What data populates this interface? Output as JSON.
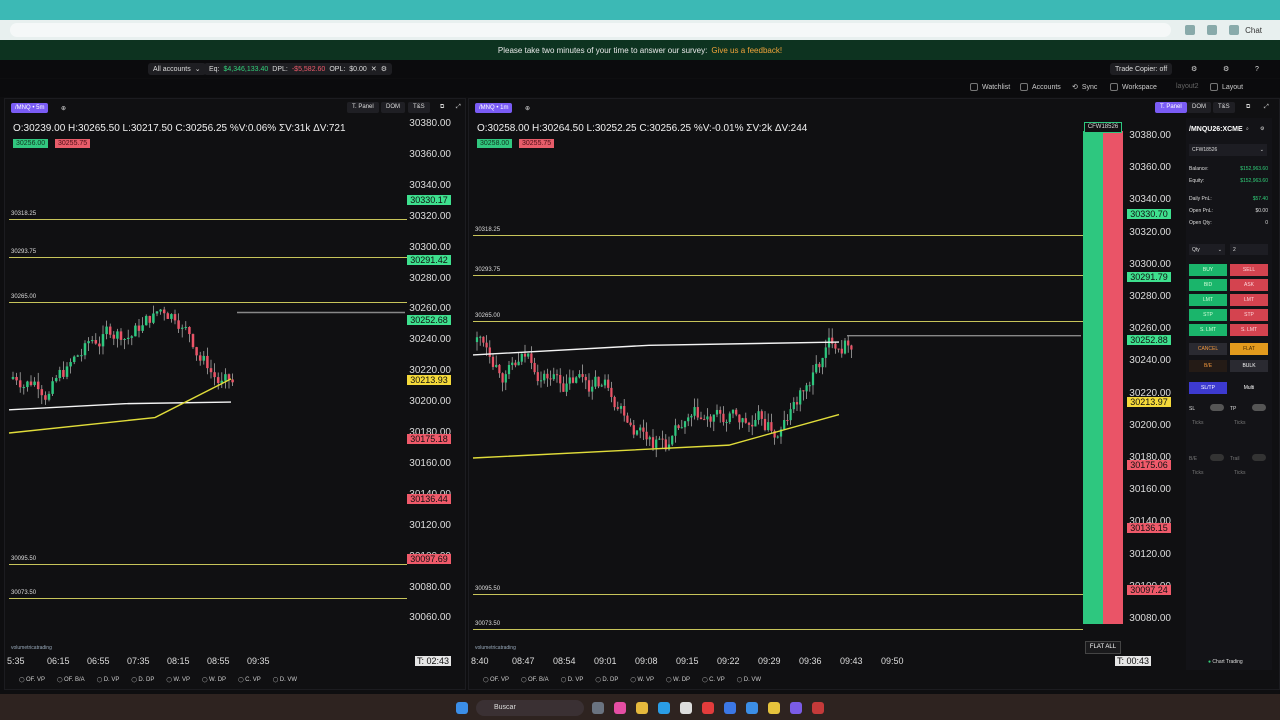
{
  "browser": {
    "chat_label": "Chat"
  },
  "survey": {
    "text": "Please take two minutes of your time to answer our survey:",
    "link": "Give us a feedback!"
  },
  "account_bar": {
    "accounts": "All accounts",
    "eq_label": "Eq:",
    "eq_value": "$4,346,133.40",
    "dpl_label": "DPL:",
    "dpl_value": "-$5,582.60",
    "opl_label": "OPL:",
    "opl_value": "$0.00",
    "trade_copier": "Trade Copier: off"
  },
  "toolbar": {
    "watchlist": "Watchlist",
    "accounts": "Accounts",
    "sync": "Sync",
    "workspace": "Workspace",
    "workspace_name": "layout2",
    "layout": "Layout"
  },
  "left_chart": {
    "symbol": "/MNQ",
    "interval": "5m",
    "tabs": [
      "T. Panel",
      "DOM",
      "T&S"
    ],
    "ohlc": "O:30239.00  H:30265.50  L:30217.50  C:30256.25  %V:0.06%  ΣV:31k  ΔV:721",
    "bid_badge": "30256.00",
    "ask_badge": "30255.75",
    "levels": [
      "30318.25",
      "30293.75",
      "30265.00",
      "30095.50",
      "30073.50"
    ],
    "yaxis": [
      "30380.00",
      "30360.00",
      "30340.00",
      "30320.00",
      "30300.00",
      "30280.00",
      "30260.00",
      "30240.00",
      "30220.00",
      "30200.00",
      "30180.00",
      "30160.00",
      "30140.00",
      "30120.00",
      "30100.00",
      "30080.00",
      "30060.00"
    ],
    "tags": [
      "30330.17",
      "30291.42",
      "30252.68",
      "30213.93",
      "30175.18",
      "30136.44",
      "30097.69"
    ],
    "xaxis": [
      "5:35",
      "06:15",
      "06:55",
      "07:35",
      "08:15",
      "08:55",
      "09:35"
    ],
    "timer": "T: 02:43"
  },
  "right_chart": {
    "symbol": "/MNQ",
    "interval": "1m",
    "tabs": [
      "T. Panel",
      "DOM",
      "T&S"
    ],
    "ohlc": "O:30258.00  H:30264.50  L:30252.25  C:30256.25  %V:-0.01%  ΣV:2k  ΔV:244",
    "bid_badge": "30258.00",
    "ask_badge": "30255.75",
    "levels": [
      "30318.25",
      "30293.75",
      "30265.00",
      "30095.50",
      "30073.50"
    ],
    "yaxis": [
      "30380.00",
      "30360.00",
      "30340.00",
      "30320.00",
      "30300.00",
      "30280.00",
      "30260.00",
      "30240.00",
      "30220.00",
      "30200.00",
      "30180.00",
      "30160.00",
      "30140.00",
      "30120.00",
      "30100.00",
      "30080.00"
    ],
    "tags": [
      "30330.70",
      "30291.79",
      "30252.88",
      "30213.97",
      "30175.06",
      "30136.15",
      "30097.24"
    ],
    "xaxis": [
      "8:40",
      "08:47",
      "08:54",
      "09:01",
      "09:08",
      "09:15",
      "09:22",
      "09:29",
      "09:36",
      "09:43",
      "09:50"
    ],
    "timer": "T: 00:43",
    "account_tag": "CFW18526",
    "flat_all": "FLAT ALL"
  },
  "vp_left": [
    "OF. VP",
    "OF. B/A",
    "D. VP",
    "D. DP",
    "W. VP",
    "W. DP",
    "C. VP",
    "D. VW"
  ],
  "vp_right": [
    "OF. VP",
    "OF. B/A",
    "D. VP",
    "D. DP",
    "W. VP",
    "W. DP",
    "C. VP",
    "D. VW"
  ],
  "logo": "volumetricatrading",
  "trade_panel": {
    "symbol": "/MNQU26:XCME",
    "account": "CFW18526",
    "balance_label": "Balance:",
    "balance": "$152,963.60",
    "equity_label": "Equity:",
    "equity": "$152,963.60",
    "daily_pnl_label": "Daily PnL:",
    "daily_pnl": "$57.40",
    "open_pnl_label": "Open PnL:",
    "open_pnl": "$0.00",
    "open_qty_label": "Open Qty:",
    "open_qty": "0",
    "qty_label": "Qty",
    "qty": "2",
    "buttons": [
      "BUY",
      "SELL",
      "BID",
      "ASK",
      "LMT",
      "LMT",
      "STP",
      "STP",
      "S. LMT",
      "S. LMT",
      "CANCEL",
      "FLAT",
      "B/E",
      "BULK"
    ],
    "sltp": "SL/TP",
    "multi": "Multi",
    "sl": "SL",
    "tp": "TP",
    "ticks": "Ticks",
    "be": "B/E",
    "trail": "Trail",
    "chart_trading": "Chart Trading"
  },
  "taskbar": {
    "search": "Buscar"
  },
  "colors": {
    "bull": "#2ec77f",
    "bear": "#ea5467",
    "level": "#c7c45a",
    "accent": "#7a5cf5"
  }
}
